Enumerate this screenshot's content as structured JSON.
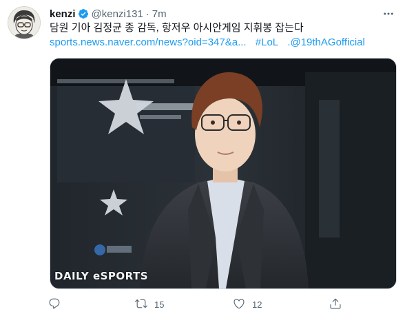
{
  "tweet": {
    "author_name": "kenzi",
    "author_handle": "@kenzi131",
    "separator": "·",
    "time": "7m",
    "text": "담원 기아 김정균 종 감독, 항저우 아시안게임 지휘봉 잡는다",
    "links": [
      "sports.news.naver.com/news?oid=347&a...",
      "#LoL",
      ".@19thAGofficial"
    ],
    "media": {
      "watermark": "DAILY eSPORTS"
    },
    "actions": {
      "reply_count": "",
      "retweet_count": "15",
      "like_count": "12"
    },
    "colors": {
      "link": "#1d9bf0",
      "verified": "#1d9bf0",
      "muted": "#536471"
    },
    "icons": {
      "verified": "verified-badge-icon",
      "more": "more-horizontal-icon",
      "reply": "reply-icon",
      "retweet": "retweet-icon",
      "like": "heart-icon",
      "share": "share-icon"
    }
  }
}
